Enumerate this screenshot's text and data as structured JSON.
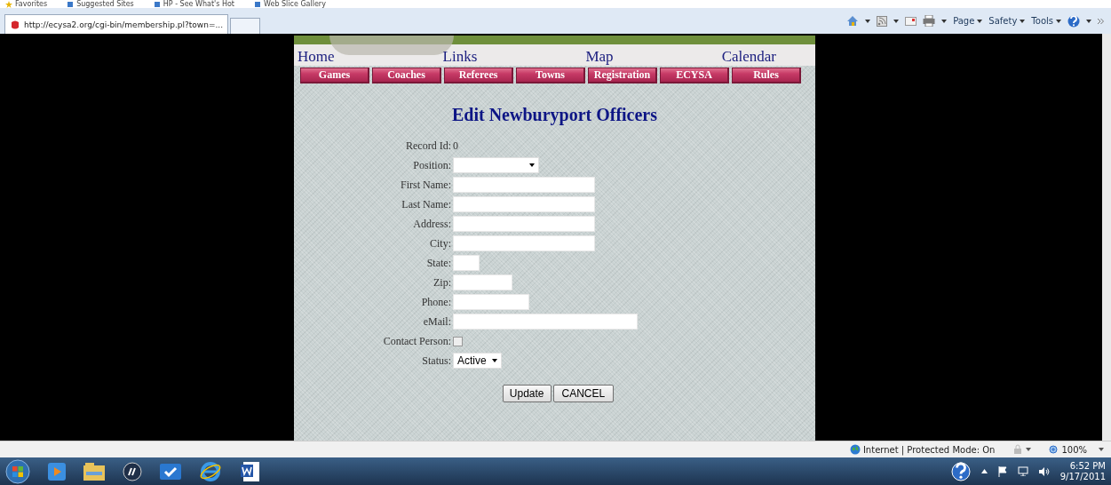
{
  "browser": {
    "favorites_bar": [
      "Favorites",
      "Suggested Sites",
      "HP - See What's Hot",
      "Web Slice Gallery"
    ],
    "tab_title": "http://ecysa2.org/cgi-bin/membership.pl?town=...",
    "command_bar": [
      "Page",
      "Safety",
      "Tools"
    ]
  },
  "nav_links": [
    "Home",
    "Links",
    "Map",
    "Calendar"
  ],
  "nav_buttons": [
    "Games",
    "Coaches",
    "Referees",
    "Towns",
    "Registration",
    "ECYSA",
    "Rules"
  ],
  "title": "Edit Newburyport Officers",
  "form": {
    "record_id": {
      "label": "Record Id:",
      "value": "0"
    },
    "fields": [
      {
        "kind": "select",
        "label": "Position:"
      },
      {
        "kind": "text",
        "label": "First Name:"
      },
      {
        "kind": "text",
        "label": "Last Name:"
      },
      {
        "kind": "text",
        "label": "Address:"
      },
      {
        "kind": "text",
        "label": "City:"
      },
      {
        "kind": "text",
        "label": "State:"
      },
      {
        "kind": "text",
        "label": "Zip:"
      },
      {
        "kind": "text",
        "label": "Phone:"
      },
      {
        "kind": "text",
        "label": "eMail:"
      },
      {
        "kind": "checkbox",
        "label": "Contact Person:",
        "checked": false
      },
      {
        "kind": "select",
        "label": "Status:",
        "value": "Active"
      }
    ],
    "buttons": [
      "Update",
      "CANCEL"
    ]
  },
  "status_bar": {
    "zone": "Internet | Protected Mode: On",
    "zoom": "100%"
  },
  "taskbar": {
    "time": "6:52 PM",
    "date": "9/17/2011"
  }
}
